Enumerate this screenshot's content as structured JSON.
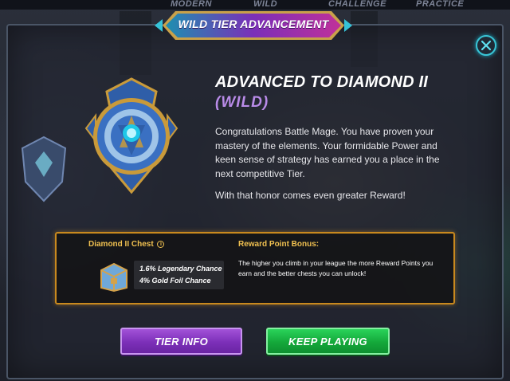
{
  "nav_tabs": [
    "MODERN",
    "WILD",
    "CHALLENGE",
    "PRACTICE"
  ],
  "modal": {
    "title": "WILD TIER ADVANCEMENT",
    "heading": "ADVANCED TO DIAMOND II",
    "subheading": "(WILD)",
    "message": "Congratulations Battle Mage. You have proven your mastery of the elements. Your formidable Power and keen sense of strategy has earned you a place in the next competitive Tier.",
    "message2": "With that honor comes even greater Reward!"
  },
  "reward": {
    "chest_title": "Diamond II Chest",
    "info_icon_glyph": "i",
    "legendary_chance": "1.6% Legendary Chance",
    "gold_foil_chance": "4% Gold Foil Chance",
    "bonus_title": "Reward Point Bonus:",
    "bonus_text": "The higher you climb in your league the more Reward Points you earn and the better chests you can unlock!"
  },
  "buttons": {
    "tier_info": "TIER INFO",
    "keep_playing": "KEEP PLAYING"
  },
  "icons": {
    "close": "close-icon",
    "badge": "diamond-tier-badge-icon",
    "chest": "chest-icon",
    "info": "info-icon"
  },
  "colors": {
    "accent_gold": "#f0c050",
    "wild_purple": "#b98be8",
    "tier_button": "#7c2fb8",
    "play_button": "#14a83a",
    "close_ring": "#39c5d6"
  }
}
